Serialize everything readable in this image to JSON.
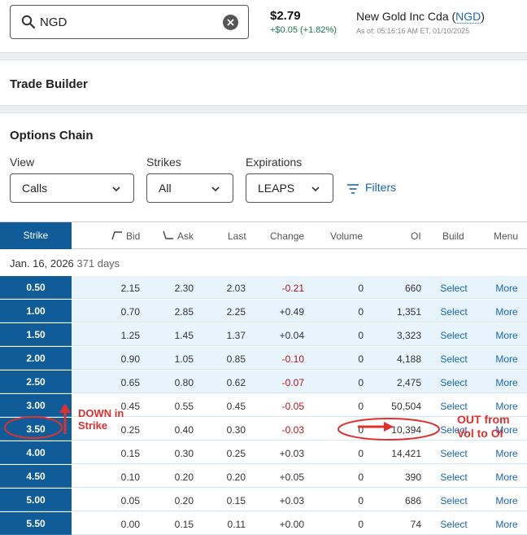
{
  "search": {
    "value": "NGD"
  },
  "quote": {
    "price": "$2.79",
    "change": "+$0.05 (+1.82%)",
    "company_prefix": "New Gold Inc Cda (",
    "ticker": "NGD",
    "company_suffix": ")",
    "as_of": "As of: 05:16:16 AM ET, 01/10/2025"
  },
  "trade_builder": {
    "title": "Trade Builder"
  },
  "options_chain": {
    "title": "Options Chain",
    "view_label": "View",
    "view_value": "Calls",
    "strikes_label": "Strikes",
    "strikes_value": "All",
    "expirations_label": "Expirations",
    "expirations_value": "LEAPS",
    "filters_label": "Filters"
  },
  "table": {
    "headers": {
      "strike": "Strike",
      "bid": "Bid",
      "ask": "Ask",
      "last": "Last",
      "change": "Change",
      "volume": "Volume",
      "oi": "OI",
      "build": "Build",
      "menu": "Menu"
    },
    "expiry_date": "Jan. 16, 2026",
    "expiry_days": "371 days",
    "rows": [
      {
        "strike": "0.50",
        "bid": "2.15",
        "ask": "2.30",
        "last": "2.03",
        "change": "-0.21",
        "volume": "0",
        "oi": "660",
        "build": "Select",
        "menu": "More"
      },
      {
        "strike": "1.00",
        "bid": "0.70",
        "ask": "2.85",
        "last": "2.25",
        "change": "+0.49",
        "volume": "0",
        "oi": "1,351",
        "build": "Select",
        "menu": "More"
      },
      {
        "strike": "1.50",
        "bid": "1.25",
        "ask": "1.45",
        "last": "1.37",
        "change": "+0.04",
        "volume": "0",
        "oi": "3,323",
        "build": "Select",
        "menu": "More"
      },
      {
        "strike": "2.00",
        "bid": "0.90",
        "ask": "1.05",
        "last": "0.85",
        "change": "-0.10",
        "volume": "0",
        "oi": "4,188",
        "build": "Select",
        "menu": "More"
      },
      {
        "strike": "2.50",
        "bid": "0.65",
        "ask": "0.80",
        "last": "0.62",
        "change": "-0.07",
        "volume": "0",
        "oi": "2,475",
        "build": "Select",
        "menu": "More"
      },
      {
        "strike": "3.00",
        "bid": "0.45",
        "ask": "0.55",
        "last": "0.45",
        "change": "-0.05",
        "volume": "0",
        "oi": "50,504",
        "build": "Select",
        "menu": "More"
      },
      {
        "strike": "3.50",
        "bid": "0.25",
        "ask": "0.40",
        "last": "0.30",
        "change": "-0.03",
        "volume": "0",
        "oi": "10,394",
        "build": "Select",
        "menu": "More"
      },
      {
        "strike": "4.00",
        "bid": "0.15",
        "ask": "0.30",
        "last": "0.25",
        "change": "+0.03",
        "volume": "0",
        "oi": "14,421",
        "build": "Select",
        "menu": "More"
      },
      {
        "strike": "4.50",
        "bid": "0.10",
        "ask": "0.20",
        "last": "0.20",
        "change": "+0.05",
        "volume": "0",
        "oi": "390",
        "build": "Select",
        "menu": "More"
      },
      {
        "strike": "5.00",
        "bid": "0.05",
        "ask": "0.20",
        "last": "0.15",
        "change": "+0.03",
        "volume": "0",
        "oi": "686",
        "build": "Select",
        "menu": "More"
      },
      {
        "strike": "5.50",
        "bid": "0.00",
        "ask": "0.15",
        "last": "0.11",
        "change": "+0.00",
        "volume": "0",
        "oi": "74",
        "build": "Select",
        "menu": "More"
      }
    ]
  },
  "annotations": {
    "down_line1": "DOWN in",
    "down_line2": "Strike",
    "out_line1": "OUT from",
    "out_line2": "Vol to OI"
  },
  "colors": {
    "strike_column": "#0f5c99",
    "in_the_money_row": "#e7f4fb",
    "link": "#1967b3",
    "negative": "#b3131a",
    "positive_change": "#1f7a4d",
    "annotation": "#e0302d"
  }
}
